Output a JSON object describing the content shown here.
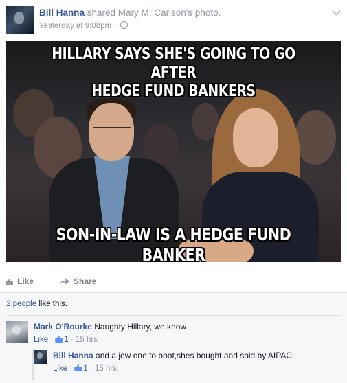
{
  "post": {
    "author": "Bill Hanna",
    "shared_text": "shared Mary M. Carlson's photo.",
    "timestamp": "Yesterday at 9:08pm",
    "separator": "·",
    "privacy_icon": "globe-icon",
    "menu_icon": "chevron-down-icon"
  },
  "photo": {
    "caption_top_line1": "HILLARY SAYS SHE'S GOING TO GO AFTER",
    "caption_top_line2": "HEDGE FUND BANKERS",
    "caption_bottom": "SON-IN-LAW IS A HEDGE FUND BANKER"
  },
  "actions": {
    "like_label": "Like",
    "share_label": "Share"
  },
  "feedback": {
    "likers_link": "2 people",
    "likers_suffix": "like this."
  },
  "comments": [
    {
      "author": "Mark O'Rourke",
      "text": "Naughty Hillary, we know",
      "like_label": "Like",
      "separator": "·",
      "like_count": "1",
      "time": "15 hrs"
    },
    {
      "author": "Bill Hanna",
      "text": "and a jew one to boot,shes bought and sold by AIPAC.",
      "like_label": "Like",
      "separator": "·",
      "like_count": "1",
      "time": "15 hrs"
    }
  ],
  "colors": {
    "link": "#3b5998",
    "meta": "#9197a3",
    "feedback_bg": "#f6f7f9"
  }
}
